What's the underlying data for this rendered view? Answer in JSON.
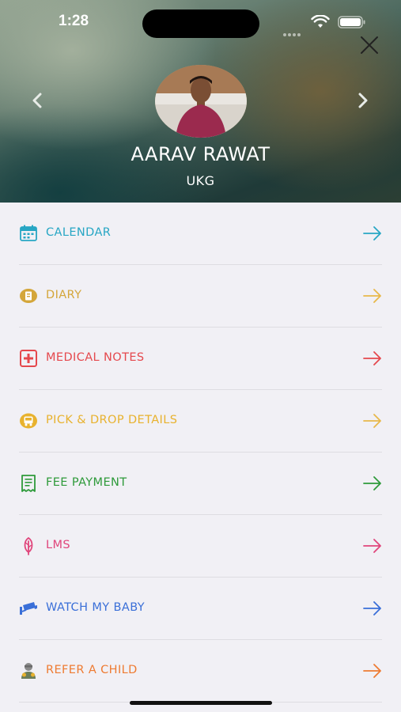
{
  "status_bar": {
    "time": "1:28"
  },
  "profile": {
    "name": "AARAV RAWAT",
    "grade": "UKG"
  },
  "menu": {
    "items": [
      {
        "label": "CALENDAR",
        "color": "#27a6c4",
        "icon": "calendar-icon"
      },
      {
        "label": "DIARY",
        "color": "#d4a63a",
        "icon": "diary-icon"
      },
      {
        "label": "MEDICAL NOTES",
        "color": "#e5484d",
        "icon": "medical-icon"
      },
      {
        "label": "PICK & DROP DETAILS",
        "color": "#e8b22e",
        "icon": "bus-icon"
      },
      {
        "label": "FEE PAYMENT",
        "color": "#2e9a3a",
        "icon": "receipt-icon"
      },
      {
        "label": "LMS",
        "color": "#e0457b",
        "icon": "lms-icon"
      },
      {
        "label": "WATCH MY BABY",
        "color": "#3a6fd8",
        "icon": "camera-icon"
      },
      {
        "label": "REFER A CHILD",
        "color": "#ee7b32",
        "icon": "refer-icon"
      }
    ]
  }
}
